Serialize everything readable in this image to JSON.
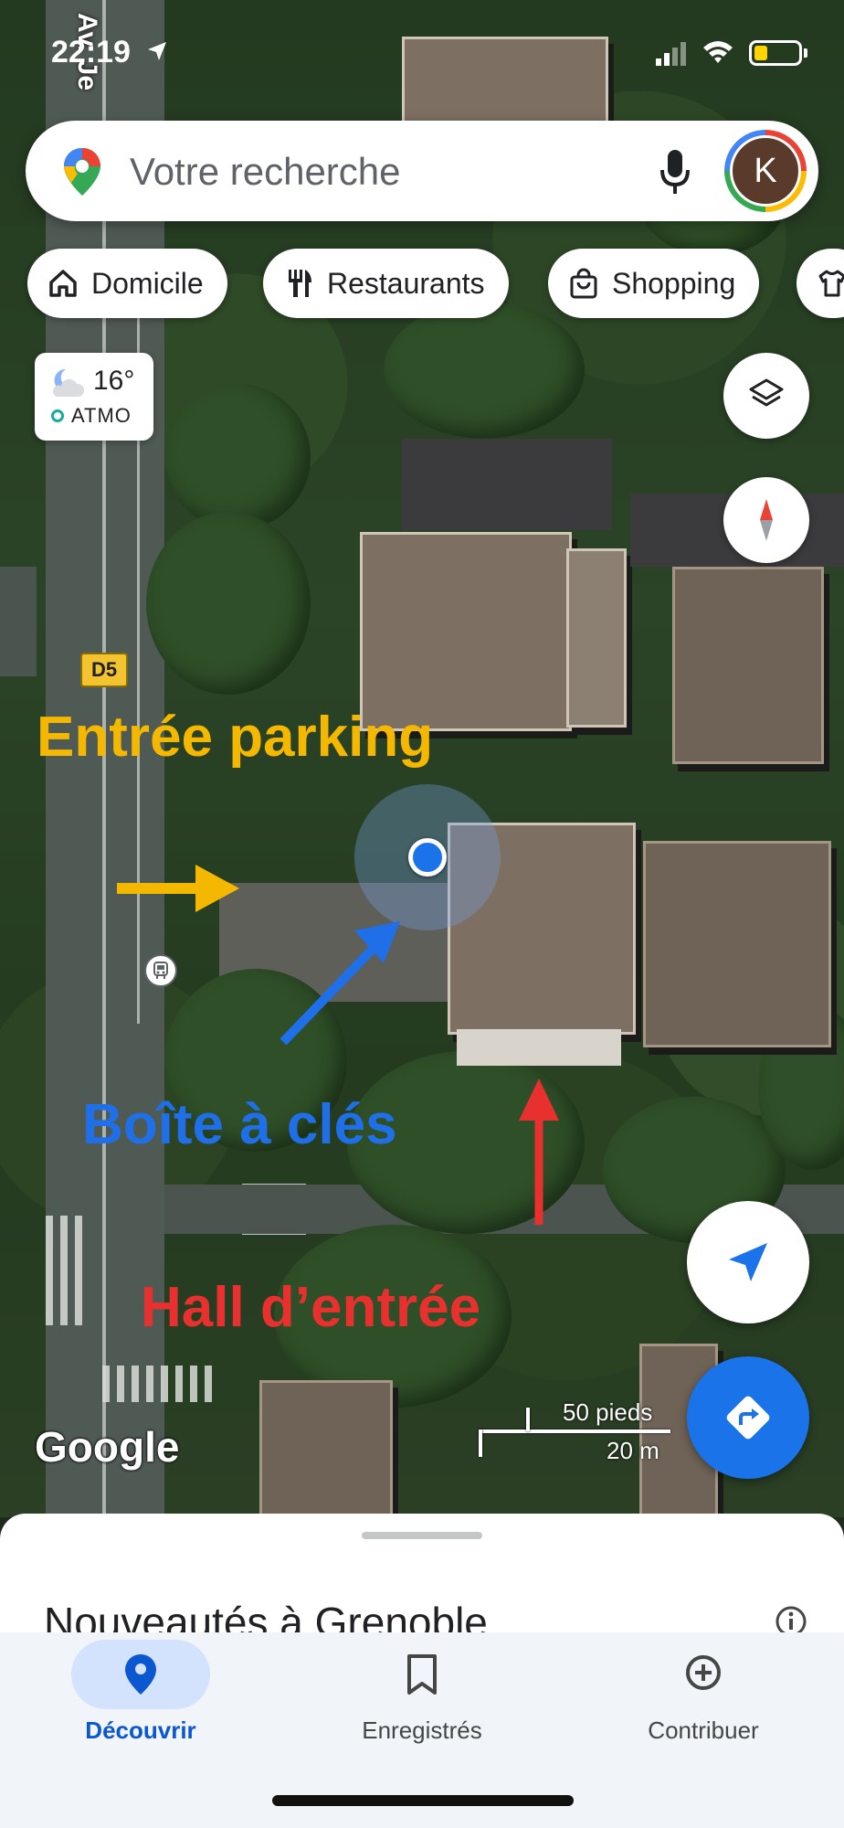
{
  "status_bar": {
    "time": "22:19",
    "battery_level": 0.3
  },
  "search": {
    "placeholder": "Votre recherche",
    "avatar_letter": "K"
  },
  "chips": [
    {
      "label": "Domicile",
      "icon": "home-icon"
    },
    {
      "label": "Restaurants",
      "icon": "restaurant-icon"
    },
    {
      "label": "Shopping",
      "icon": "shopping-bag-icon"
    },
    {
      "label": "",
      "icon": "shirt-icon"
    }
  ],
  "weather": {
    "temp": "16°",
    "air_quality": "ATMO"
  },
  "map": {
    "street_label": "Av. Je",
    "route_badge": "D5",
    "google_logo": "Google",
    "scale_feet": "50 pieds",
    "scale_meters": "20 m"
  },
  "annotations": {
    "parking": "Entrée parking",
    "key_box": "Boîte à clés",
    "hall": "Hall d’entrée",
    "colors": {
      "parking": "#f5b800",
      "key_box": "#1f6fe8",
      "hall": "#e8302f"
    }
  },
  "sheet": {
    "title": "Nouveautés à Grenoble"
  },
  "nav": {
    "items": [
      {
        "label": "Découvrir",
        "icon": "explore-pin-icon",
        "active": true
      },
      {
        "label": "Enregistrés",
        "icon": "bookmark-icon",
        "active": false
      },
      {
        "label": "Contribuer",
        "icon": "add-circle-icon",
        "active": false
      }
    ]
  },
  "colors": {
    "accent": "#1a73e8",
    "nav_active_pill": "#d3e3fd"
  }
}
